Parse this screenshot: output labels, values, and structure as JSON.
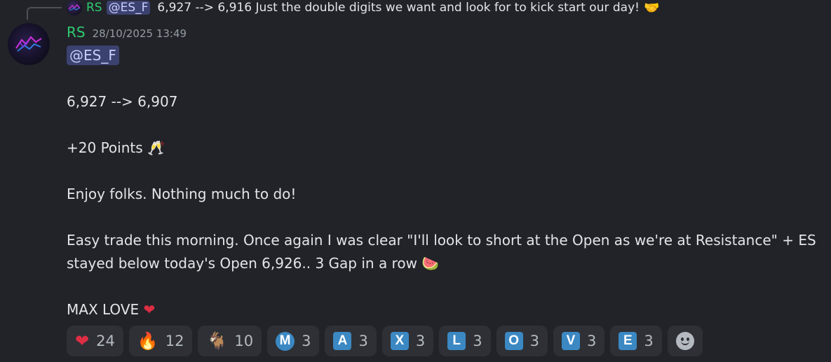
{
  "reply": {
    "author": "RS",
    "mention": "@ES_F",
    "text": "6,927 --> 6,916  Just the double digits we want and look for to kick start our day!",
    "emoji": "🤝"
  },
  "message": {
    "author": "RS",
    "timestamp": "28/10/2025 13:49",
    "mention": "@ES_F",
    "lines": {
      "trade": "6,927 --> 6,907",
      "points": "+20 Points",
      "points_emoji": "🥂",
      "enjoy": "Enjoy folks. Nothing much to do!",
      "easy1": "Easy trade this morning. Once again I was clear \"I'll look to short at the Open as we're at Resistance\"  + ES",
      "easy2": "stayed below today's Open 6,926.. 3 Gap in a row",
      "easy2_emoji": "🍉",
      "love": "MAX LOVE",
      "love_emoji": "❤"
    }
  },
  "reactions": [
    {
      "emoji": "❤",
      "count": "24"
    },
    {
      "emoji": "🔥",
      "count": "12"
    },
    {
      "emoji": "🐐",
      "count": "10"
    },
    {
      "letter": "M",
      "count": "3"
    },
    {
      "letter": "A",
      "count": "3"
    },
    {
      "letter": "X",
      "count": "3"
    },
    {
      "letter": "L",
      "count": "3"
    },
    {
      "letter": "O",
      "count": "3"
    },
    {
      "letter": "V",
      "count": "3"
    },
    {
      "letter": "E",
      "count": "3"
    }
  ],
  "colors": {
    "background": "#222328",
    "author": "#2ecc71",
    "mention_bg": "#3c4270",
    "reaction_bg": "#2e3035",
    "letter_box": "#3b88c3"
  }
}
